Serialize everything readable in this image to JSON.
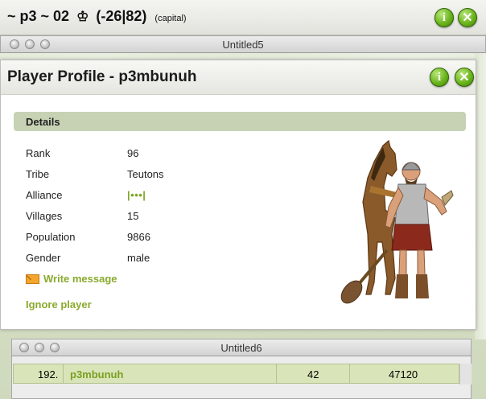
{
  "village_window": {
    "title_prefix": "~ p3 ~ 02",
    "king_icon": "♔",
    "coordinates": "(-26|82)",
    "capital_label": "(capital)"
  },
  "window_untitled5": {
    "title": "Untitled5"
  },
  "profile": {
    "title": "Player Profile - p3mbunuh",
    "details_heading": "Details",
    "rows": [
      {
        "label": "Rank",
        "value": "96"
      },
      {
        "label": "Tribe",
        "value": "Teutons"
      },
      {
        "label": "Alliance",
        "value": "|•••|"
      },
      {
        "label": "Villages",
        "value": "15"
      },
      {
        "label": "Population",
        "value": "9866"
      },
      {
        "label": "Gender",
        "value": "male"
      }
    ],
    "write_message": "Write message",
    "ignore_player": "Ignore player",
    "avatar_icon": "teuton-warrior-with-horse"
  },
  "window_untitled6": {
    "title": "Untitled6",
    "row": {
      "rank": "192.",
      "name": "p3mbunuh",
      "col3": "42",
      "col4": "47120"
    }
  },
  "buttons": {
    "info_glyph": "i",
    "close_glyph": "✕"
  },
  "colors": {
    "accent_green": "#6cb51d",
    "link_green": "#8aaa2d",
    "details_bar": "#c7d2b5"
  }
}
